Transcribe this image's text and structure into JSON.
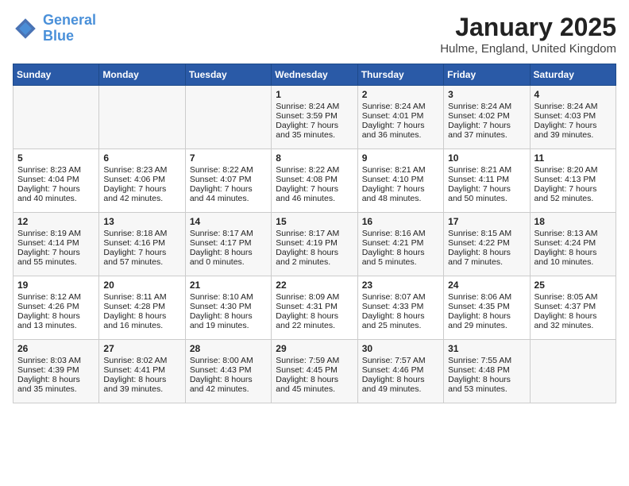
{
  "header": {
    "logo_line1": "General",
    "logo_line2": "Blue",
    "month": "January 2025",
    "location": "Hulme, England, United Kingdom"
  },
  "weekdays": [
    "Sunday",
    "Monday",
    "Tuesday",
    "Wednesday",
    "Thursday",
    "Friday",
    "Saturday"
  ],
  "weeks": [
    [
      {
        "day": "",
        "content": ""
      },
      {
        "day": "",
        "content": ""
      },
      {
        "day": "",
        "content": ""
      },
      {
        "day": "1",
        "content": "Sunrise: 8:24 AM\nSunset: 3:59 PM\nDaylight: 7 hours and 35 minutes."
      },
      {
        "day": "2",
        "content": "Sunrise: 8:24 AM\nSunset: 4:01 PM\nDaylight: 7 hours and 36 minutes."
      },
      {
        "day": "3",
        "content": "Sunrise: 8:24 AM\nSunset: 4:02 PM\nDaylight: 7 hours and 37 minutes."
      },
      {
        "day": "4",
        "content": "Sunrise: 8:24 AM\nSunset: 4:03 PM\nDaylight: 7 hours and 39 minutes."
      }
    ],
    [
      {
        "day": "5",
        "content": "Sunrise: 8:23 AM\nSunset: 4:04 PM\nDaylight: 7 hours and 40 minutes."
      },
      {
        "day": "6",
        "content": "Sunrise: 8:23 AM\nSunset: 4:06 PM\nDaylight: 7 hours and 42 minutes."
      },
      {
        "day": "7",
        "content": "Sunrise: 8:22 AM\nSunset: 4:07 PM\nDaylight: 7 hours and 44 minutes."
      },
      {
        "day": "8",
        "content": "Sunrise: 8:22 AM\nSunset: 4:08 PM\nDaylight: 7 hours and 46 minutes."
      },
      {
        "day": "9",
        "content": "Sunrise: 8:21 AM\nSunset: 4:10 PM\nDaylight: 7 hours and 48 minutes."
      },
      {
        "day": "10",
        "content": "Sunrise: 8:21 AM\nSunset: 4:11 PM\nDaylight: 7 hours and 50 minutes."
      },
      {
        "day": "11",
        "content": "Sunrise: 8:20 AM\nSunset: 4:13 PM\nDaylight: 7 hours and 52 minutes."
      }
    ],
    [
      {
        "day": "12",
        "content": "Sunrise: 8:19 AM\nSunset: 4:14 PM\nDaylight: 7 hours and 55 minutes."
      },
      {
        "day": "13",
        "content": "Sunrise: 8:18 AM\nSunset: 4:16 PM\nDaylight: 7 hours and 57 minutes."
      },
      {
        "day": "14",
        "content": "Sunrise: 8:17 AM\nSunset: 4:17 PM\nDaylight: 8 hours and 0 minutes."
      },
      {
        "day": "15",
        "content": "Sunrise: 8:17 AM\nSunset: 4:19 PM\nDaylight: 8 hours and 2 minutes."
      },
      {
        "day": "16",
        "content": "Sunrise: 8:16 AM\nSunset: 4:21 PM\nDaylight: 8 hours and 5 minutes."
      },
      {
        "day": "17",
        "content": "Sunrise: 8:15 AM\nSunset: 4:22 PM\nDaylight: 8 hours and 7 minutes."
      },
      {
        "day": "18",
        "content": "Sunrise: 8:13 AM\nSunset: 4:24 PM\nDaylight: 8 hours and 10 minutes."
      }
    ],
    [
      {
        "day": "19",
        "content": "Sunrise: 8:12 AM\nSunset: 4:26 PM\nDaylight: 8 hours and 13 minutes."
      },
      {
        "day": "20",
        "content": "Sunrise: 8:11 AM\nSunset: 4:28 PM\nDaylight: 8 hours and 16 minutes."
      },
      {
        "day": "21",
        "content": "Sunrise: 8:10 AM\nSunset: 4:30 PM\nDaylight: 8 hours and 19 minutes."
      },
      {
        "day": "22",
        "content": "Sunrise: 8:09 AM\nSunset: 4:31 PM\nDaylight: 8 hours and 22 minutes."
      },
      {
        "day": "23",
        "content": "Sunrise: 8:07 AM\nSunset: 4:33 PM\nDaylight: 8 hours and 25 minutes."
      },
      {
        "day": "24",
        "content": "Sunrise: 8:06 AM\nSunset: 4:35 PM\nDaylight: 8 hours and 29 minutes."
      },
      {
        "day": "25",
        "content": "Sunrise: 8:05 AM\nSunset: 4:37 PM\nDaylight: 8 hours and 32 minutes."
      }
    ],
    [
      {
        "day": "26",
        "content": "Sunrise: 8:03 AM\nSunset: 4:39 PM\nDaylight: 8 hours and 35 minutes."
      },
      {
        "day": "27",
        "content": "Sunrise: 8:02 AM\nSunset: 4:41 PM\nDaylight: 8 hours and 39 minutes."
      },
      {
        "day": "28",
        "content": "Sunrise: 8:00 AM\nSunset: 4:43 PM\nDaylight: 8 hours and 42 minutes."
      },
      {
        "day": "29",
        "content": "Sunrise: 7:59 AM\nSunset: 4:45 PM\nDaylight: 8 hours and 45 minutes."
      },
      {
        "day": "30",
        "content": "Sunrise: 7:57 AM\nSunset: 4:46 PM\nDaylight: 8 hours and 49 minutes."
      },
      {
        "day": "31",
        "content": "Sunrise: 7:55 AM\nSunset: 4:48 PM\nDaylight: 8 hours and 53 minutes."
      },
      {
        "day": "",
        "content": ""
      }
    ]
  ]
}
